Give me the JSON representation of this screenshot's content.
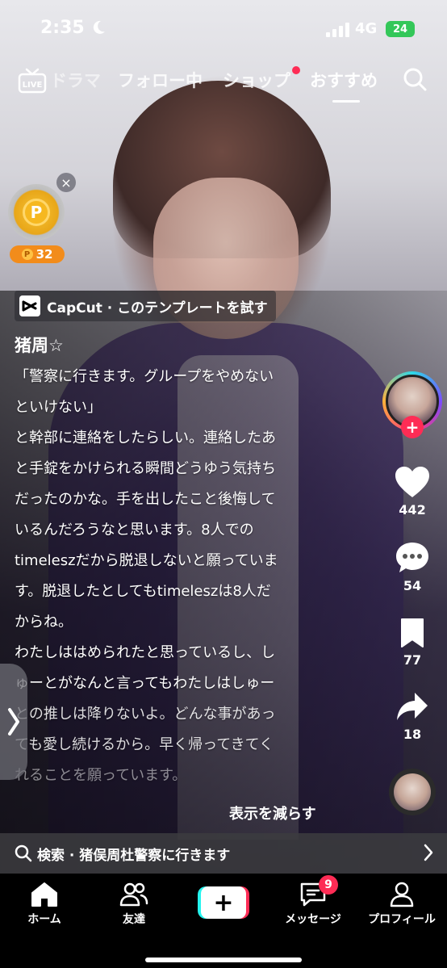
{
  "status_bar": {
    "time": "2:35",
    "network": "4G",
    "battery": "24"
  },
  "top_nav": {
    "tabs": [
      {
        "label": "ドラマ"
      },
      {
        "label": "フォロー中"
      },
      {
        "label": "ショップ"
      },
      {
        "label": "おすすめ"
      }
    ],
    "active_tab": "おすすめ"
  },
  "coin_widget": {
    "points": "32"
  },
  "capcut": {
    "label": "CapCut · このテンプレートを試す"
  },
  "post": {
    "author": "猪周☆",
    "caption_lines": [
      "「警察に行きます。グループをやめない",
      "といけない」",
      "と幹部に連絡をしたらしい。連絡したあ",
      "と手錠をかけられる瞬間どうゆう気持ち",
      "だったのかな。手を出したこと後悔して",
      "いるんだろうなと思います。8人での",
      "timeleszだから脱退しないと願っていま",
      "す。脱退したとしてもtimeleszは8人だ",
      "からね。",
      "わたしははめられたと思っているし、し",
      "ゅーとがなんと言ってもわたしはしゅー",
      "との推しは降りないよ。どんな事があっ",
      "ても愛し続けるから。早く帰ってきてく",
      "れることを願っています。"
    ],
    "show_less": "表示を減らす"
  },
  "actions": {
    "likes": "442",
    "comments": "54",
    "saves": "77",
    "shares": "18"
  },
  "search_suggestion": {
    "text": "検索 · 猪俣周杜警察に行きます"
  },
  "bottom_nav": {
    "home": "ホーム",
    "friends": "友達",
    "messages": "メッセージ",
    "messages_badge": "9",
    "profile": "プロフィール"
  },
  "colors": {
    "accent": "#fe2c55",
    "cyan": "#25f4ee",
    "coin": "#f6b820"
  }
}
